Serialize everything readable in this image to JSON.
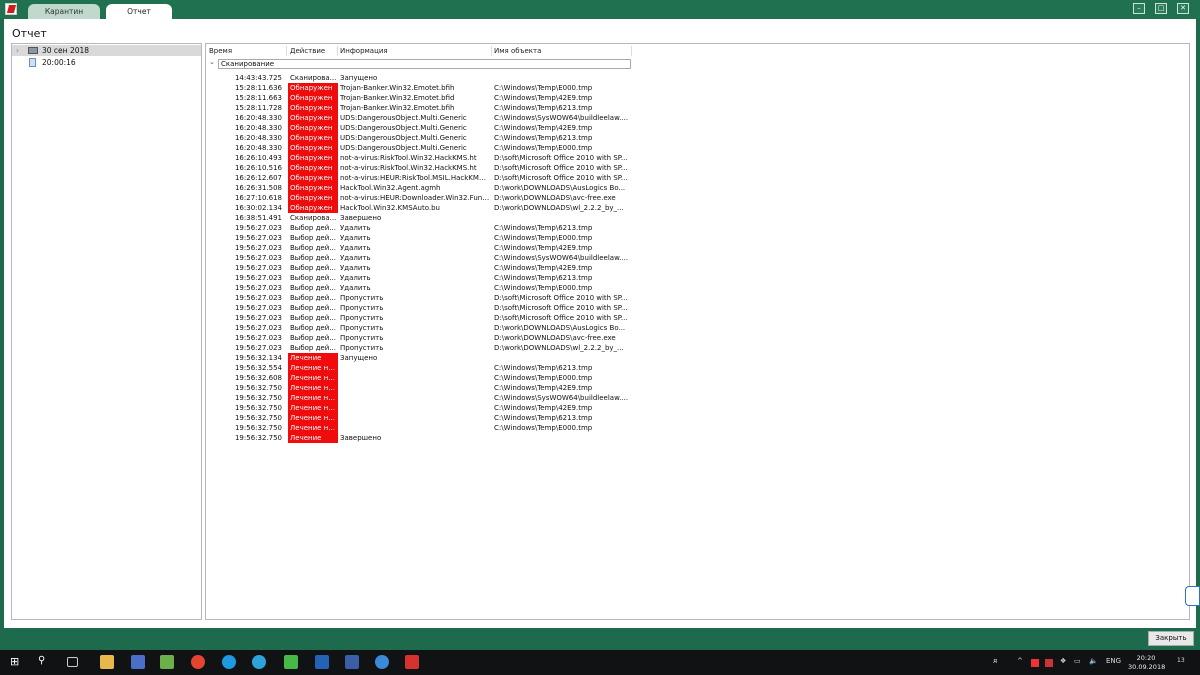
{
  "tabs": [
    "Карантин",
    "Отчет"
  ],
  "page_title": "Отчет",
  "tree": [
    {
      "label": "30 сен 2018",
      "icon": "folder-icon"
    },
    {
      "label": "20:00:16",
      "icon": "document-icon"
    }
  ],
  "columns": [
    "Время",
    "Действие",
    "Информация",
    "Имя объекта"
  ],
  "group_label": "Сканирование",
  "rows": [
    [
      "14:43:43.725",
      "Сканирова...",
      "Запущено",
      "",
      0
    ],
    [
      "15:28:11.636",
      "Обнаружен",
      "Trojan-Banker.Win32.Emotet.bfih",
      "C:\\Windows\\Temp\\E000.tmp",
      1
    ],
    [
      "15:28:11.663",
      "Обнаружен",
      "Trojan-Banker.Win32.Emotet.bfid",
      "C:\\Windows\\Temp\\42E9.tmp",
      1
    ],
    [
      "15:28:11.728",
      "Обнаружен",
      "Trojan-Banker.Win32.Emotet.bfih",
      "C:\\Windows\\Temp\\6213.tmp",
      1
    ],
    [
      "16:20:48.330",
      "Обнаружен",
      "UDS:DangerousObject.Multi.Generic",
      "C:\\Windows\\SysWOW64\\buildleelaw....",
      1
    ],
    [
      "16:20:48.330",
      "Обнаружен",
      "UDS:DangerousObject.Multi.Generic",
      "C:\\Windows\\Temp\\42E9.tmp",
      1
    ],
    [
      "16:20:48.330",
      "Обнаружен",
      "UDS:DangerousObject.Multi.Generic",
      "C:\\Windows\\Temp\\6213.tmp",
      1
    ],
    [
      "16:20:48.330",
      "Обнаружен",
      "UDS:DangerousObject.Multi.Generic",
      "C:\\Windows\\Temp\\E000.tmp",
      1
    ],
    [
      "16:26:10.493",
      "Обнаружен",
      "not-a-virus:RiskTool.Win32.HackKMS.ht",
      "D:\\soft\\Microsoft Office 2010 with SP...",
      1
    ],
    [
      "16:26:10.516",
      "Обнаружен",
      "not-a-virus:RiskTool.Win32.HackKMS.ht",
      "D:\\soft\\Microsoft Office 2010 with SP...",
      1
    ],
    [
      "16:26:12.607",
      "Обнаружен",
      "not-a-virus:HEUR:RiskTool.MSIL.HackKMS....",
      "D:\\soft\\Microsoft Office 2010 with SP...",
      1
    ],
    [
      "16:26:31.508",
      "Обнаружен",
      "HackTool.Win32.Agent.agmh",
      "D:\\work\\DOWNLOADS\\AusLogics Bo...",
      1
    ],
    [
      "16:27:10.618",
      "Обнаружен",
      "not-a-virus:HEUR:Downloader.Win32.Funs...",
      "D:\\work\\DOWNLOADS\\avc-free.exe",
      1
    ],
    [
      "16:30:02.134",
      "Обнаружен",
      "HackTool.Win32.KMSAuto.bu",
      "D:\\work\\DOWNLOADS\\wl_2.2.2_by_...",
      1
    ],
    [
      "16:38:51.491",
      "Сканирова...",
      "Завершено",
      "",
      0
    ],
    [
      "19:56:27.023",
      "Выбор дей...",
      "Удалить",
      "C:\\Windows\\Temp\\6213.tmp",
      0
    ],
    [
      "19:56:27.023",
      "Выбор дей...",
      "Удалить",
      "C:\\Windows\\Temp\\E000.tmp",
      0
    ],
    [
      "19:56:27.023",
      "Выбор дей...",
      "Удалить",
      "C:\\Windows\\Temp\\42E9.tmp",
      0
    ],
    [
      "19:56:27.023",
      "Выбор дей...",
      "Удалить",
      "C:\\Windows\\SysWOW64\\buildleelaw....",
      0
    ],
    [
      "19:56:27.023",
      "Выбор дей...",
      "Удалить",
      "C:\\Windows\\Temp\\42E9.tmp",
      0
    ],
    [
      "19:56:27.023",
      "Выбор дей...",
      "Удалить",
      "C:\\Windows\\Temp\\6213.tmp",
      0
    ],
    [
      "19:56:27.023",
      "Выбор дей...",
      "Удалить",
      "C:\\Windows\\Temp\\E000.tmp",
      0
    ],
    [
      "19:56:27.023",
      "Выбор дей...",
      "Пропустить",
      "D:\\soft\\Microsoft Office 2010 with SP...",
      0
    ],
    [
      "19:56:27.023",
      "Выбор дей...",
      "Пропустить",
      "D:\\soft\\Microsoft Office 2010 with SP...",
      0
    ],
    [
      "19:56:27.023",
      "Выбор дей...",
      "Пропустить",
      "D:\\soft\\Microsoft Office 2010 with SP...",
      0
    ],
    [
      "19:56:27.023",
      "Выбор дей...",
      "Пропустить",
      "D:\\work\\DOWNLOADS\\AusLogics Bo...",
      0
    ],
    [
      "19:56:27.023",
      "Выбор дей...",
      "Пропустить",
      "D:\\work\\DOWNLOADS\\avc-free.exe",
      0
    ],
    [
      "19:56:27.023",
      "Выбор дей...",
      "Пропустить",
      "D:\\work\\DOWNLOADS\\wl_2.2.2_by_...",
      0
    ],
    [
      "19:56:32.134",
      "Лечение",
      "Запущено",
      "",
      1
    ],
    [
      "19:56:32.554",
      "Лечение н...",
      "",
      "C:\\Windows\\Temp\\6213.tmp",
      1
    ],
    [
      "19:56:32.608",
      "Лечение н...",
      "",
      "C:\\Windows\\Temp\\E000.tmp",
      1
    ],
    [
      "19:56:32.750",
      "Лечение н...",
      "",
      "C:\\Windows\\Temp\\42E9.tmp",
      1
    ],
    [
      "19:56:32.750",
      "Лечение н...",
      "",
      "C:\\Windows\\SysWOW64\\buildleelaw....",
      1
    ],
    [
      "19:56:32.750",
      "Лечение н...",
      "",
      "C:\\Windows\\Temp\\42E9.tmp",
      1
    ],
    [
      "19:56:32.750",
      "Лечение н...",
      "",
      "C:\\Windows\\Temp\\6213.tmp",
      1
    ],
    [
      "19:56:32.750",
      "Лечение н...",
      "",
      "C:\\Windows\\Temp\\E000.tmp",
      1
    ],
    [
      "19:56:32.750",
      "Лечение",
      "Завершено",
      "",
      1
    ]
  ],
  "close_label": "Закрыть",
  "taskbar": {
    "lang": "ENG",
    "time": "20:20",
    "date": "30.09.2018",
    "notif_count": "13"
  },
  "colors": {
    "frame": "#1d6a4c",
    "alert": "#f00c0c",
    "taskbar": "#101214"
  }
}
